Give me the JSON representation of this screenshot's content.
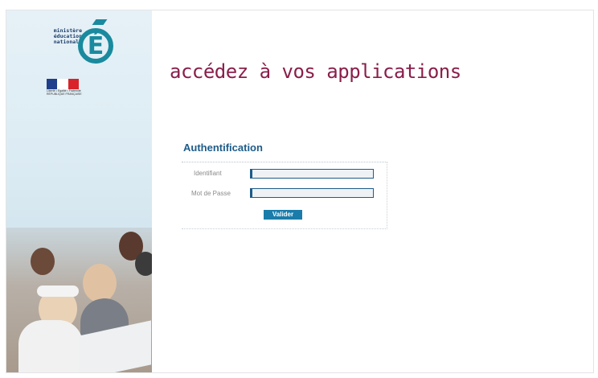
{
  "header": {
    "title": "accédez à vos applications",
    "ministry_text": "ministère\néducation\nnationale",
    "logo_letter": "É",
    "marianne_caption": "Liberté • Égalité • Fraternité\nRÉPUBLIQUE FRANÇAISE"
  },
  "login": {
    "heading": "Authentification",
    "identifier_label": "Identifiant",
    "identifier_value": "",
    "password_label": "Mot de Passe",
    "password_value": "",
    "submit_label": "Valider"
  },
  "colors": {
    "accent_title": "#8a1e4a",
    "accent_blue": "#1d5c88",
    "logo_teal": "#1a8a9e",
    "button_bg": "#1a7caa"
  }
}
